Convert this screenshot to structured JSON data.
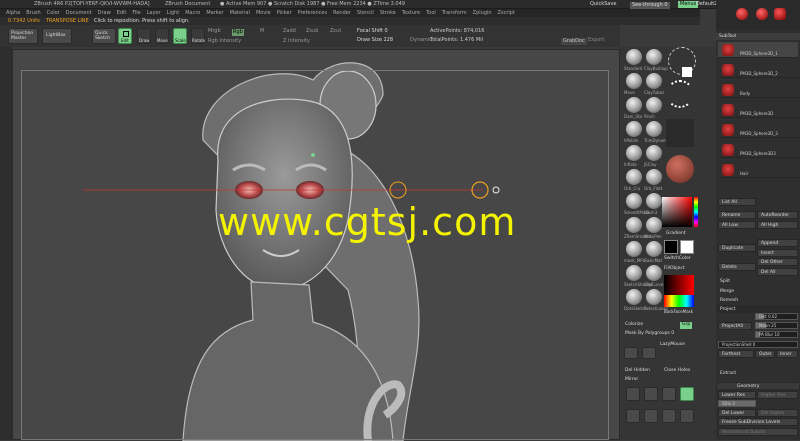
{
  "titlebar": {
    "app": "ZBrush 4R6 P2[TOFI-YERF-QKVI-WVWM-HADA]",
    "document": "ZBrush Document",
    "stats": "● Active Mem 907 ● Scratch Disk 1987 ● Free Mem 2234 ● ZTime 3.049",
    "quicksave": "QuickSave",
    "seethrough": "See-through 0",
    "menus": "Menus",
    "script": "DefaultZScript"
  },
  "menubar": {
    "items": [
      "Alpha",
      "Brush",
      "Color",
      "Document",
      "Draw",
      "Edit",
      "File",
      "Layer",
      "Light",
      "Macro",
      "Marker",
      "Material",
      "Movie",
      "Picker",
      "Preferences",
      "Render",
      "Stencil",
      "Stroke",
      "Texture",
      "Tool",
      "Transform",
      "Zplugin",
      "Zscript"
    ]
  },
  "notebar": {
    "units": "0.7342 Units",
    "transpose": "TRANSPOSE LINE",
    "hint": "Click to reposition. Press shift to align."
  },
  "toolbar": {
    "projection_master": "Projection Master",
    "lightbox": "LightBox",
    "quick_sketch": "Quick Sketch",
    "edit": "Edit",
    "draw": "Draw",
    "move": "Move",
    "scale": "Scale",
    "rotate": "Rotate",
    "mrgb": "Mrgb",
    "rgb": "Rgb",
    "m": "M",
    "zadd": "Zadd",
    "zsub": "Zsub",
    "zcut": "Zcut",
    "rgb_intensity": "Rgb Intensity",
    "z_intensity": "Z Intensity",
    "focal_shift": "Focal Shift 0",
    "draw_size": "Draw Size 228",
    "dynamic": "Dynamic",
    "active_points": "ActivePoints: 874,016",
    "total_points": "TotalPoints: 1.476 Mil",
    "grab_doc": "GrabDoc",
    "export": "Export"
  },
  "watermark": "www.cgtsj.com",
  "shelf": {
    "brushes": [
      "Standard",
      "ClayBuildup",
      "Move",
      "ClayTubes",
      "Dam_Sta",
      "Pinch",
      "hPolish",
      "TrimDynam",
      "Inflate",
      "JSClay",
      "Orb_Cra",
      "Orb_Flatt",
      "SmoothMask",
      "Slash3",
      "ZRemSmooth",
      "MaskPen",
      "mask_MPc",
      "BasicMat",
      "SketchShaded",
      "ClipCurve",
      "DotsSketch",
      "SelectLasso"
    ],
    "gradient": "Gradient",
    "switch_color": "SwitchColor",
    "fill_object": "FillObject",
    "alternate": "Alternate",
    "backface_mask": "BackFaceMask",
    "colorize": "Colorize",
    "grp": "Grp",
    "mask_by_polygroups": "Mask By Polygroups 0",
    "lazy_mouse": "LazyMouse",
    "del_hidden": "Del Hidden",
    "close_holes": "Close Holes",
    "mirror": "Mirror",
    "groups_split": "GrpSplit",
    "split_hidden": "Split Hidden",
    "zero_btn": "Zero",
    "polyf": "PolyF",
    "local": "Local",
    "xyz": "Xyz",
    "persp": "Persp",
    "floor": "Floor"
  },
  "rightpanel": {
    "subtool_header": "SubTool",
    "subtools": [
      "PM3D_Sphere3D_1",
      "PM3D_Sphere3D_2",
      "Body",
      "PM3D_Sphere3D",
      "PM3D_Sphere3D_3",
      "PM3D_Sphere3D3",
      "Hair"
    ],
    "list_all": "List All",
    "rename": "Rename",
    "autoreorder": "AutoReorder",
    "all_low": "All Low",
    "all_high": "All High",
    "duplicate": "Duplicate",
    "append": "Append",
    "insert": "Insert",
    "delete": "Delete",
    "del_other": "Del Other",
    "del_all": "Del All",
    "split": "Split",
    "merge": "Merge",
    "remesh": "Remesh",
    "project": "Project",
    "project_all": "ProjectAll",
    "dist": "Dist 0.02",
    "mean": "Mean 25",
    "pa_blur": "PA Blur 10",
    "projection_shell": "ProjectionShell 0",
    "farthest": "Farthest",
    "outer": "Outer",
    "inner": "Inner",
    "extract": "Extract",
    "geometry": "Geometry",
    "lower_res": "Lower Res",
    "higher_res": "Higher Res",
    "sdiv": "SDiv 3",
    "del_lower": "Del Lower",
    "del_higher": "Del Higher",
    "freeze": "Freeze SubDivision Levels",
    "reconstruct": "Reconstruct Subdiv"
  },
  "colors": {
    "accent_green": "#7ad08a",
    "watermark": "#f4f400",
    "active_orange": "#f0a020"
  }
}
